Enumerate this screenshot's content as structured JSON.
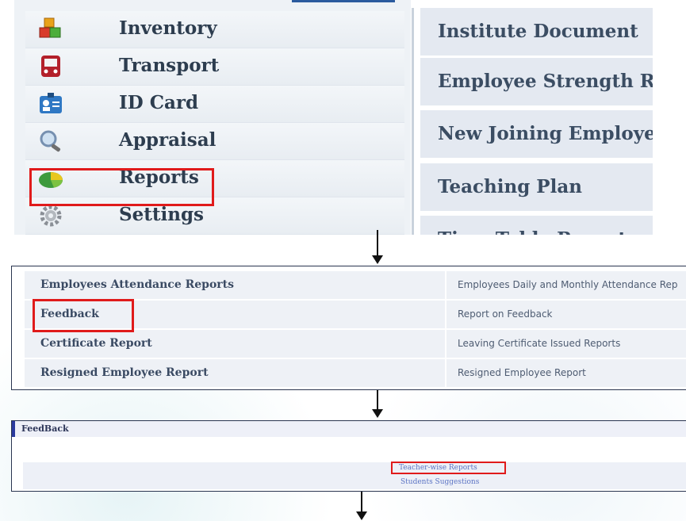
{
  "menu": {
    "items": [
      {
        "label": "Inventory",
        "icon": "inventory-cubes-icon"
      },
      {
        "label": "Transport",
        "icon": "bus-icon"
      },
      {
        "label": "ID Card",
        "icon": "id-card-icon"
      },
      {
        "label": "Appraisal",
        "icon": "magnifier-icon"
      },
      {
        "label": "Reports",
        "icon": "pie-chart-icon"
      },
      {
        "label": "Settings",
        "icon": "gear-icon"
      }
    ],
    "highlighted": "Reports"
  },
  "report_list": {
    "items": [
      "Institute Document",
      "Employee Strength R",
      "New Joining Employe",
      "Teaching Plan",
      "Time Table Report"
    ]
  },
  "reports_table": {
    "rows": [
      {
        "name": "Employees Attendance Reports",
        "description": "Employees Daily and Monthly Attendance Rep"
      },
      {
        "name": "Feedback",
        "description": "Report on Feedback"
      },
      {
        "name": "Certificate Report",
        "description": "Leaving Certificate Issued Reports"
      },
      {
        "name": "Resigned Employee Report",
        "description": "Resigned Employee Report"
      }
    ],
    "highlighted": "Feedback"
  },
  "feedback_panel": {
    "title": "FeedBack",
    "links": [
      "Teacher-wise Reports",
      "Students Suggestions"
    ],
    "highlighted": "Teacher-wise Reports"
  },
  "colors": {
    "highlight": "#e01b1b",
    "menu_text": "#2d3d4f",
    "link": "#5b73c4"
  }
}
